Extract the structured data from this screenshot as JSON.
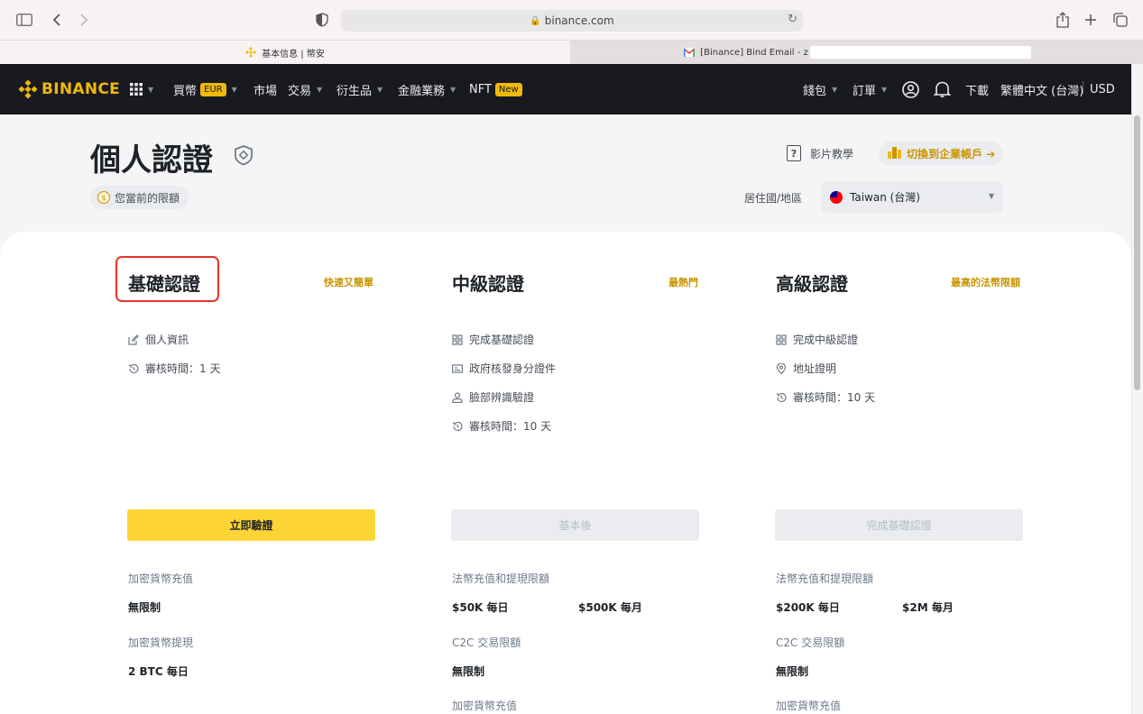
{
  "browser": {
    "url": "binance.com",
    "tabs": [
      {
        "title": "基本信息 | 幣安"
      },
      {
        "title": "[Binance] Bind Email - z"
      }
    ]
  },
  "nav": {
    "brand": "BINANCE",
    "left_items": [
      {
        "label": "買幣",
        "badge": "EUR"
      },
      {
        "label": "市場"
      },
      {
        "label": "交易"
      },
      {
        "label": "衍生品"
      },
      {
        "label": "金融業務"
      },
      {
        "label": "NFT",
        "badge": "New"
      }
    ],
    "right_items": {
      "wallet": "錢包",
      "orders": "訂單",
      "download": "下載",
      "language": "繁體中文 (台灣)",
      "currency": "USD"
    }
  },
  "header": {
    "title": "個人認證",
    "current_limit": "您當前的限額",
    "video_tutorial": "影片教學",
    "switch_account": "切換到企業帳戶 ➔",
    "residence_label": "居住國/地區",
    "residence_value": "Taiwan (台灣)"
  },
  "levels": [
    {
      "title": "基礎認證",
      "tag": "快速又簡單",
      "requirements": [
        {
          "icon": "edit-icon",
          "text": "個人資訊"
        },
        {
          "icon": "clock-icon",
          "text": "審核時間：1 天"
        }
      ],
      "button": "立即驗證",
      "limits": [
        {
          "label": "加密貨幣充值",
          "value": "無限制"
        },
        {
          "label": "加密貨幣提現",
          "value": "2 BTC 每日"
        }
      ]
    },
    {
      "title": "中級認證",
      "tag": "最熱門",
      "requirements": [
        {
          "icon": "grid-icon",
          "text": "完成基礎認證"
        },
        {
          "icon": "id-card-icon",
          "text": "政府核發身分證件"
        },
        {
          "icon": "person-icon",
          "text": "臉部辨識驗證"
        },
        {
          "icon": "clock-icon",
          "text": "審核時間：10 天"
        }
      ],
      "button": "基本後",
      "limits": [
        {
          "label": "法幣充值和提現限額",
          "value": "$50K 每日",
          "value2": "$500K 每月"
        },
        {
          "label": "C2C 交易限額",
          "value": "無限制"
        },
        {
          "label": "加密貨幣充值"
        }
      ]
    },
    {
      "title": "高級認證",
      "tag": "最高的法幣限額",
      "requirements": [
        {
          "icon": "grid-icon",
          "text": "完成中級認證"
        },
        {
          "icon": "location-icon",
          "text": "地址證明"
        },
        {
          "icon": "clock-icon",
          "text": "審核時間：10 天"
        }
      ],
      "button": "完成基礎認證",
      "limits": [
        {
          "label": "法幣充值和提現限額",
          "value": "$200K 每日",
          "value2": "$2M 每月"
        },
        {
          "label": "C2C 交易限額",
          "value": "無限制"
        },
        {
          "label": "加密貨幣充值"
        }
      ]
    }
  ]
}
